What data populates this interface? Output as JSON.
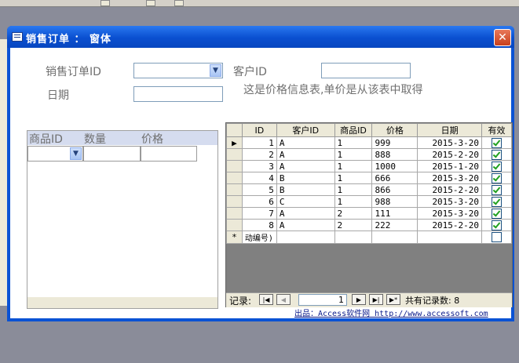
{
  "window": {
    "title": "销售订单 ： 窗体",
    "close_glyph": "✕"
  },
  "form": {
    "order_id_label": "销售订单ID",
    "date_label": "日期",
    "customer_id_label": "客户ID",
    "info_text": "这是价格信息表,单价是从该表中取得",
    "order_id_value": "",
    "date_value": "",
    "customer_id_value": ""
  },
  "subform": {
    "headers": [
      "商品ID",
      "数量",
      "价格"
    ]
  },
  "datasheet": {
    "headers": [
      "ID",
      "客户ID",
      "商品ID",
      "价格",
      "日期",
      "有效"
    ],
    "rows": [
      {
        "id": "1",
        "customer": "A",
        "product": "1",
        "price": "999",
        "date": "2015-3-20",
        "valid": true
      },
      {
        "id": "2",
        "customer": "A",
        "product": "1",
        "price": "888",
        "date": "2015-2-20",
        "valid": true
      },
      {
        "id": "3",
        "customer": "A",
        "product": "1",
        "price": "1000",
        "date": "2015-1-20",
        "valid": true
      },
      {
        "id": "4",
        "customer": "B",
        "product": "1",
        "price": "666",
        "date": "2015-3-20",
        "valid": true
      },
      {
        "id": "5",
        "customer": "B",
        "product": "1",
        "price": "866",
        "date": "2015-2-20",
        "valid": true
      },
      {
        "id": "6",
        "customer": "C",
        "product": "1",
        "price": "988",
        "date": "2015-3-20",
        "valid": true
      },
      {
        "id": "7",
        "customer": "A",
        "product": "2",
        "price": "111",
        "date": "2015-3-20",
        "valid": true
      },
      {
        "id": "8",
        "customer": "A",
        "product": "2",
        "price": "222",
        "date": "2015-2-20",
        "valid": true
      }
    ],
    "new_row_marker": "*",
    "new_row_id": "动编号)",
    "current_row_marker": "▶"
  },
  "navigator": {
    "label": "记录:",
    "position": "1",
    "total_text": "共有记录数: 8",
    "first": "|◀",
    "prev": "◀",
    "next": "▶",
    "last": "▶|",
    "new": "▶*"
  },
  "footer": {
    "text": "出品：Access软件网 http://www.accessoft.com"
  },
  "icons": {
    "combo_arrow": "▼"
  }
}
